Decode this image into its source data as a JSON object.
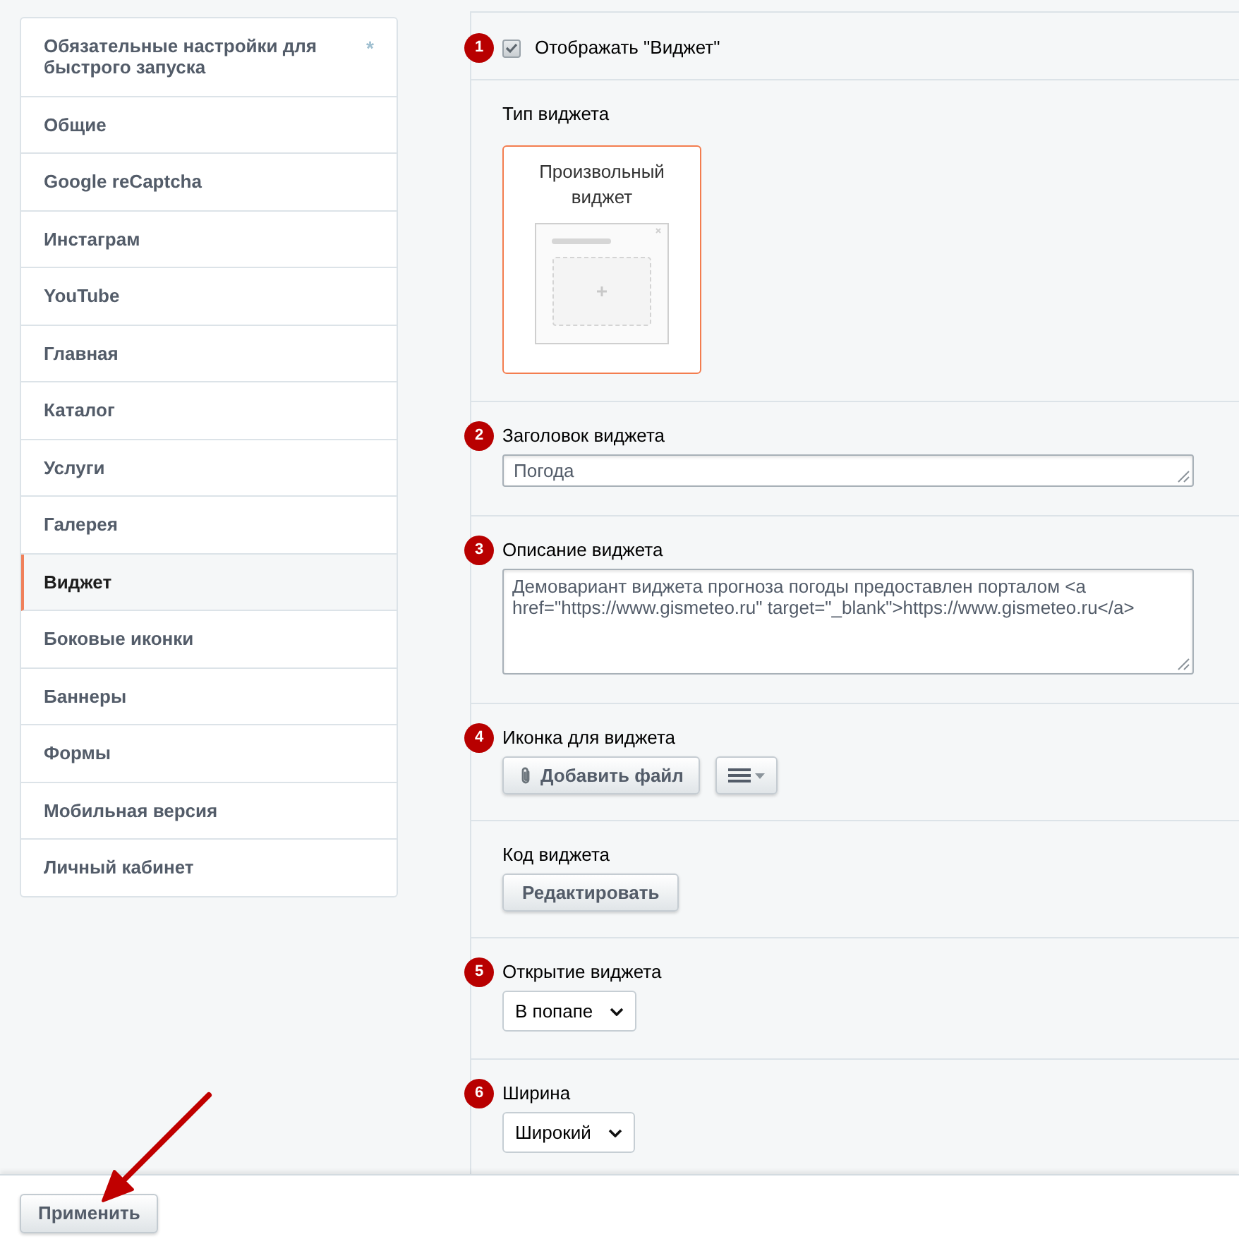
{
  "sidebar": {
    "items": [
      {
        "label": "Обязательные настройки для быстрого запуска",
        "selected": false,
        "required_mark": "*"
      },
      {
        "label": "Общие",
        "selected": false
      },
      {
        "label": "Google reCaptcha",
        "selected": false
      },
      {
        "label": "Инстаграм",
        "selected": false
      },
      {
        "label": "YouTube",
        "selected": false
      },
      {
        "label": "Главная",
        "selected": false
      },
      {
        "label": "Каталог",
        "selected": false
      },
      {
        "label": "Услуги",
        "selected": false
      },
      {
        "label": "Галерея",
        "selected": false
      },
      {
        "label": "Виджет",
        "selected": true
      },
      {
        "label": "Боковые иконки",
        "selected": false
      },
      {
        "label": "Баннеры",
        "selected": false
      },
      {
        "label": "Формы",
        "selected": false
      },
      {
        "label": "Мобильная версия",
        "selected": false
      },
      {
        "label": "Личный кабинет",
        "selected": false
      }
    ]
  },
  "settings": {
    "sections": [
      {
        "kind": "checkbox",
        "step": "1",
        "label": "Отображать \"Виджет\"",
        "checked": true
      },
      {
        "kind": "widget_type",
        "label": "Тип виджета",
        "options": [
          {
            "label": "Произвольный виджет",
            "selected": true
          }
        ]
      },
      {
        "kind": "text",
        "step": "2",
        "label": "Заголовок виджета",
        "value": "Погода"
      },
      {
        "kind": "textarea",
        "step": "3",
        "label": "Описание виджета",
        "value": "Демовариант виджета прогноза погоды предоставлен порталом <a href=\"https://www.gismeteo.ru\" target=\"_blank\">https://www.gismeteo.ru</a>"
      },
      {
        "kind": "file",
        "step": "4",
        "label": "Иконка для виджета",
        "button": "Добавить файл"
      },
      {
        "kind": "button",
        "label": "Код виджета",
        "button": "Редактировать"
      },
      {
        "kind": "select",
        "step": "5",
        "label": "Открытие виджета",
        "value": "В попапе"
      },
      {
        "kind": "select",
        "step": "6",
        "label": "Ширина",
        "value": "Широкий"
      }
    ]
  },
  "footer": {
    "apply_button": "Применить"
  }
}
